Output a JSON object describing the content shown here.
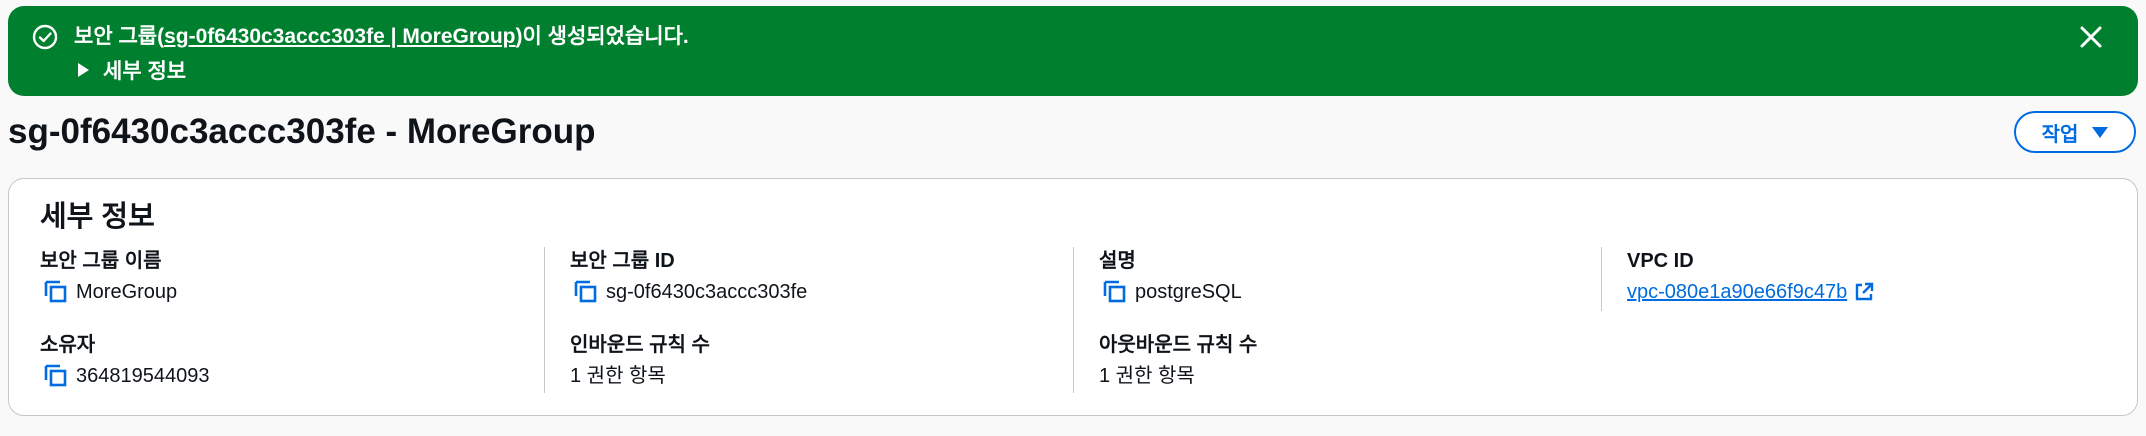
{
  "banner": {
    "message_prefix": "보안 그룹(",
    "message_link": "sg-0f6430c3accc303fe | MoreGroup",
    "message_suffix": ")이 생성되었습니다.",
    "details_label": "세부 정보",
    "status_icon": "check-circle-icon",
    "close_icon": "close-icon",
    "color": "#00802f"
  },
  "header": {
    "title": "sg-0f6430c3accc303fe - MoreGroup",
    "actions_label": "작업"
  },
  "details": {
    "title": "세부 정보",
    "fields": {
      "sg_name": {
        "label": "보안 그룹 이름",
        "value": "MoreGroup"
      },
      "sg_id": {
        "label": "보안 그룹 ID",
        "value": "sg-0f6430c3accc303fe"
      },
      "description": {
        "label": "설명",
        "value": "postgreSQL"
      },
      "vpc_id": {
        "label": "VPC ID",
        "value": "vpc-080e1a90e66f9c47b"
      },
      "owner": {
        "label": "소유자",
        "value": "364819544093"
      },
      "inbound_count": {
        "label": "인바운드 규칙 수",
        "value": "1 권한 항목"
      },
      "outbound_count": {
        "label": "아웃바운드 규칙 수",
        "value": "1 권한 항목"
      }
    }
  },
  "colors": {
    "accent": "#006ce0",
    "success": "#00802f",
    "border": "#c6c6cd"
  }
}
